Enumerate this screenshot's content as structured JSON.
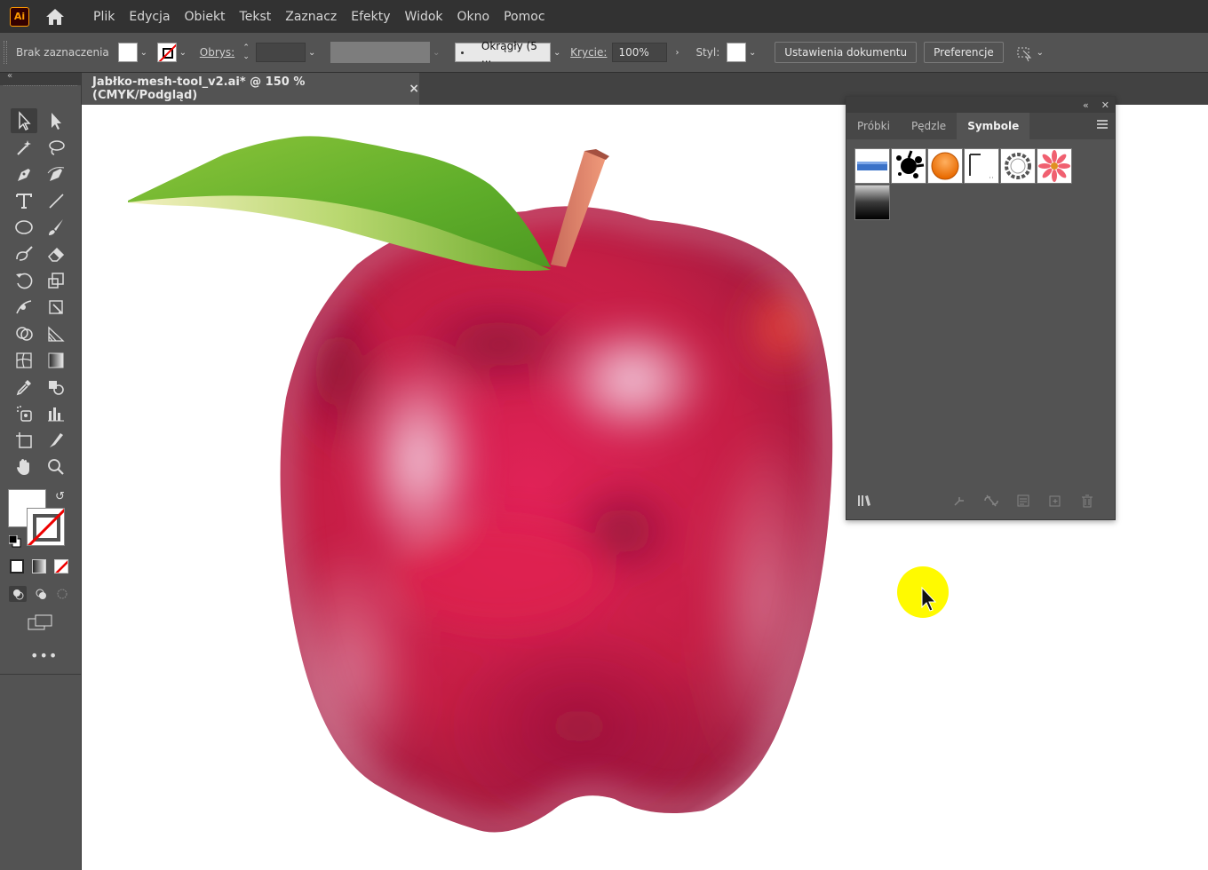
{
  "app": {
    "logo_text": "Ai"
  },
  "menu": {
    "items": [
      "Plik",
      "Edycja",
      "Obiekt",
      "Tekst",
      "Zaznacz",
      "Efekty",
      "Widok",
      "Okno",
      "Pomoc"
    ]
  },
  "control_bar": {
    "selection_label": "Brak zaznaczenia",
    "stroke_label": "Obrys:",
    "brush_value": "Okrągły (5 ...",
    "opacity_label": "Krycie:",
    "opacity_value": "100%",
    "style_label": "Styl:",
    "doc_settings_button": "Ustawienia dokumentu",
    "preferences_button": "Preferencje"
  },
  "document": {
    "tab_title": "Jabłko-mesh-tool_v2.ai* @ 150 % (CMYK/Podgląd)",
    "close_glyph": "×"
  },
  "panel": {
    "tabs": [
      "Próbki",
      "Pędzle",
      "Symbole"
    ],
    "active_tab": "Symbole",
    "symbols": [
      "blue-banner",
      "ink-splash",
      "orange-button",
      "grunge-frame",
      "ornament-ring",
      "pink-flower",
      "dark-gradient"
    ]
  },
  "colors": {
    "ui_bg": "#535353",
    "menubar_bg": "#323232",
    "canvas_bg": "#ffffff",
    "apple_red": "#c51e45",
    "leaf_green": "#6bb52a",
    "cursor_highlight": "#fffa00"
  }
}
